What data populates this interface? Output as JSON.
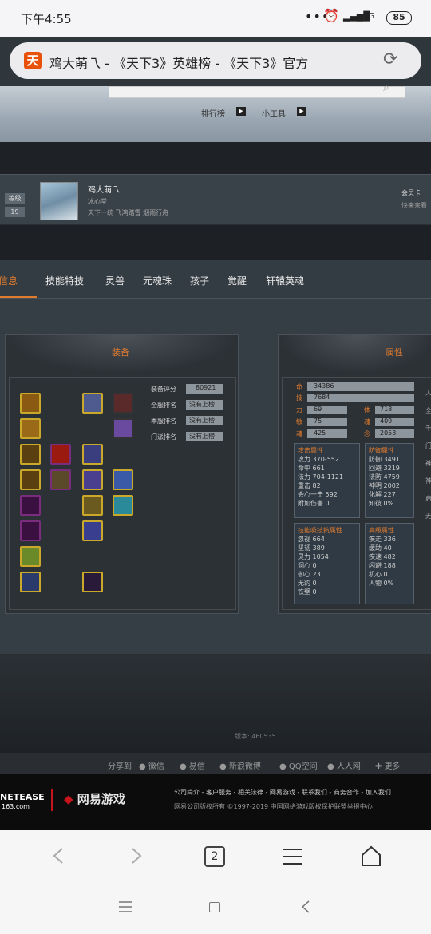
{
  "status": {
    "time": "下午4:55",
    "battery": "85",
    "network": "4G"
  },
  "browser": {
    "url_title": "鸡大萌乁 - 《天下3》英雄榜 - 《天下3》官方",
    "tab_count": "2"
  },
  "hero": {
    "nav1": "排行榜",
    "nav2": "小工具"
  },
  "profile": {
    "level_label": "等级",
    "level": "19",
    "name": "鸡大萌乁",
    "school": "冰心堂",
    "server": "天下一统 飞鸿踏雪 烟雨行舟",
    "right_top": "会员卡",
    "right_bottom": "快来来看"
  },
  "tabs": [
    {
      "label": "信息"
    },
    {
      "label": "技能特技"
    },
    {
      "label": "灵兽"
    },
    {
      "label": "元魂珠"
    },
    {
      "label": "孩子"
    },
    {
      "label": "觉醒"
    },
    {
      "label": "轩辕英魂"
    }
  ],
  "equip": {
    "title": "装备",
    "score_label": "装备评分",
    "score": "80921",
    "rank1_label": "全服排名",
    "rank1": "没有上榜",
    "rank2_label": "本服排名",
    "rank2": "没有上榜",
    "rank3_label": "门派排名",
    "rank3": "没有上榜"
  },
  "attr": {
    "title": "属性",
    "main": [
      {
        "k": "命",
        "v": "34386"
      },
      {
        "k": "技",
        "v": "7684"
      }
    ],
    "pairs": [
      {
        "k1": "力",
        "v1": "69",
        "k2": "体",
        "v2": "718"
      },
      {
        "k1": "敏",
        "v1": "75",
        "k2": "魂",
        "v2": "409"
      },
      {
        "k1": "魂",
        "v1": "425",
        "k2": "念",
        "v2": "2053"
      }
    ],
    "attack_title": "攻击属性",
    "attack": [
      "攻力 370-552",
      "命中 661",
      "法力 704-1121",
      "重击 82",
      "会心一击 592",
      "附加伤害 0"
    ],
    "defense_title": "防御属性",
    "defense": [
      "防御 3491",
      "回避 3219",
      "法防 4759",
      "神明 2002",
      "化解 227",
      "知彼 0%"
    ],
    "special_title": "技能吸技抗属性",
    "special": [
      "忽视 664",
      "坚韧 389",
      "灵力 1054",
      "洞心 0",
      "御心 23",
      "无豹 0",
      "铁壁 0"
    ],
    "adv_title": "高级属性",
    "adv": [
      "疾走 336",
      "缓助 40",
      "疾速 482",
      "闪避 188",
      "机心 0",
      "人物 0%"
    ],
    "side": [
      "人",
      "全",
      "千",
      "门",
      "神",
      "神",
      "启",
      "无"
    ]
  },
  "version": "版本: 460535",
  "social": [
    "分享到",
    "微信",
    "易信",
    "新浪微博",
    "QQ空间",
    "人人网",
    "更多"
  ],
  "footer": {
    "logo1": "NETEASE",
    "logo1_sub": "163.com",
    "logo2": "网易游戏",
    "links": "公司简介 - 客户服务 - 相关法律 - 网易游戏 - 联系我们 - 商务合作 - 加入我们",
    "copyright": "网易公司版权所有 ©1997-2019    中国网络游戏版权保护联盟举报中心"
  }
}
